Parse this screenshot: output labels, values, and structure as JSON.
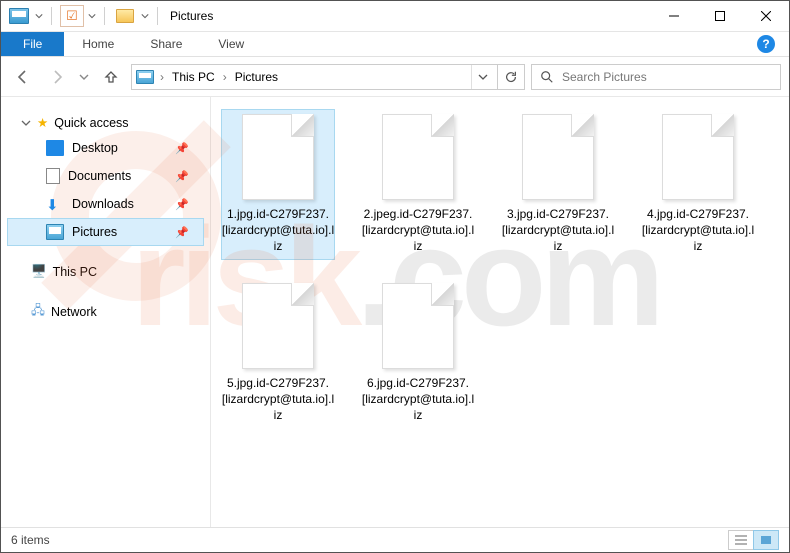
{
  "title": "Pictures",
  "tabs": {
    "file": "File",
    "home": "Home",
    "share": "Share",
    "view": "View"
  },
  "breadcrumb": {
    "root": "This PC",
    "current": "Pictures"
  },
  "search": {
    "placeholder": "Search Pictures"
  },
  "sidebar": {
    "quickAccess": "Quick access",
    "items": [
      {
        "label": "Desktop",
        "icon": "desktop"
      },
      {
        "label": "Documents",
        "icon": "doc"
      },
      {
        "label": "Downloads",
        "icon": "down"
      },
      {
        "label": "Pictures",
        "icon": "pic",
        "selected": true
      }
    ],
    "thisPC": "This PC",
    "network": "Network"
  },
  "files": [
    {
      "name": "1.jpg.id-C279F237.[lizardcrypt@tuta.io].liz",
      "selected": true
    },
    {
      "name": "2.jpeg.id-C279F237.[lizardcrypt@tuta.io].liz"
    },
    {
      "name": "3.jpg.id-C279F237.[lizardcrypt@tuta.io].liz"
    },
    {
      "name": "4.jpg.id-C279F237.[lizardcrypt@tuta.io].liz"
    },
    {
      "name": "5.jpg.id-C279F237.[lizardcrypt@tuta.io].liz"
    },
    {
      "name": "6.jpg.id-C279F237.[lizardcrypt@tuta.io].liz"
    }
  ],
  "status": "6 items"
}
